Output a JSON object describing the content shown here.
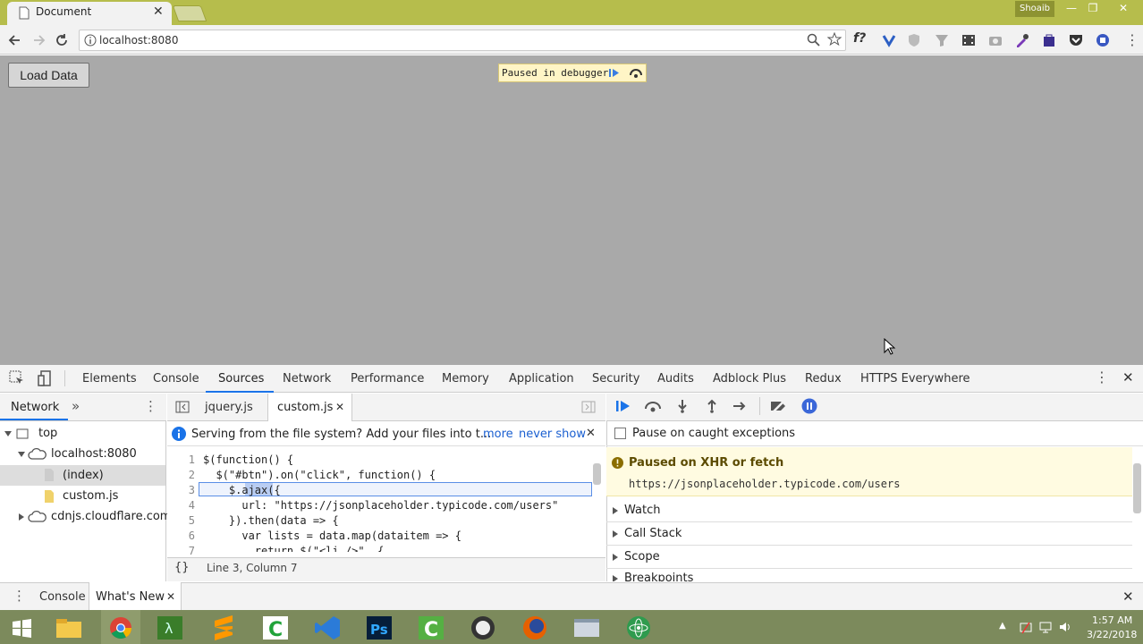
{
  "browser": {
    "tab_title": "Document",
    "profile_name": "Shoaib",
    "url": "localhost:8080"
  },
  "page": {
    "load_button": "Load Data",
    "debugger_banner": "Paused in debugger"
  },
  "devtools": {
    "tabs": [
      "Elements",
      "Console",
      "Sources",
      "Network",
      "Performance",
      "Memory",
      "Application",
      "Security",
      "Audits",
      "Adblock Plus",
      "Redux",
      "HTTPS Everywhere"
    ],
    "active_tab": "Sources",
    "navigator": {
      "tab": "Network",
      "tree": [
        "top",
        "localhost:8080",
        "(index)",
        "custom.js",
        "cdnjs.cloudflare.com"
      ]
    },
    "editor": {
      "files": [
        "jquery.js",
        "custom.js"
      ],
      "infobar_text": "Serving from the file system? Add your files into t...",
      "infobar_more": "more",
      "infobar_never": "never show",
      "lines": [
        {
          "n": "1",
          "code": "$(function() {"
        },
        {
          "n": "2",
          "code": "  $(\"#btn\").on(\"click\", function() {"
        },
        {
          "n": "3",
          "code": "    $.ajax({"
        },
        {
          "n": "4",
          "code": "      url: \"https://jsonplaceholder.typicode.com/users\""
        },
        {
          "n": "5",
          "code": "    }).then(data => {"
        },
        {
          "n": "6",
          "code": "      var lists = data.map(dataitem => {"
        },
        {
          "n": "7",
          "code": "        return $(\"<li />\", {"
        }
      ],
      "status": "Line 3, Column 7",
      "format_icon": "{}"
    },
    "debugger": {
      "pause_on_caught": "Pause on caught exceptions",
      "paused_title": "Paused on XHR or fetch",
      "paused_url": "https://jsonplaceholder.typicode.com/users",
      "sections": [
        "Watch",
        "Call Stack",
        "Scope",
        "Breakpoints"
      ]
    },
    "drawer": {
      "tabs": [
        "Console",
        "What's New"
      ]
    }
  },
  "taskbar": {
    "time": "1:57 AM",
    "date": "3/22/2018"
  }
}
